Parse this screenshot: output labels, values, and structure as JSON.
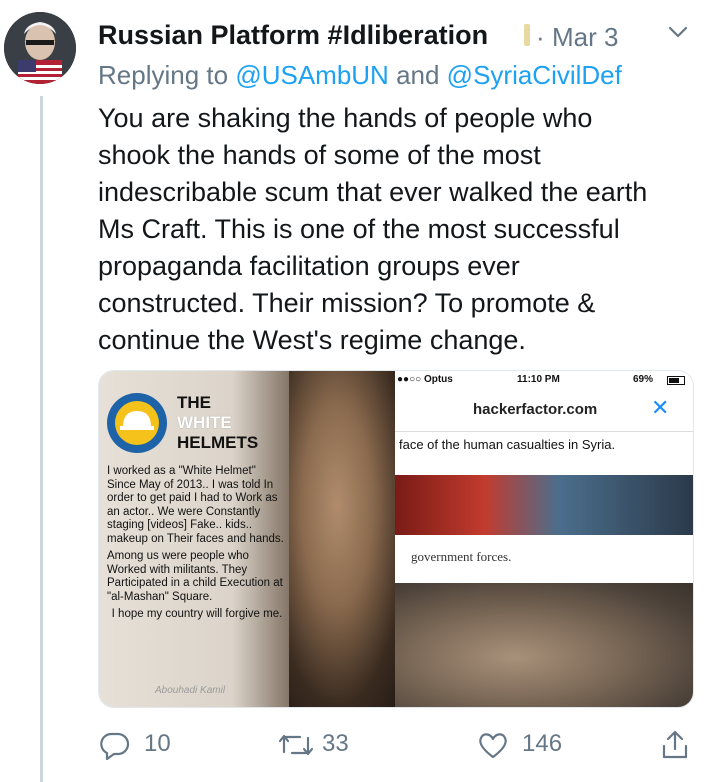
{
  "tweet": {
    "author_name": "Russian Platform #Idliberation",
    "separator": "·",
    "date": "Mar 3",
    "reply_prefix": "Replying to ",
    "reply_mention_1": "@USAmbUN",
    "reply_and": " and ",
    "reply_mention_2": "@SyriaCivilDef",
    "text_lines": [
      "You are shaking the hands of people who",
      "shook the hands of some of the most",
      "indescribable scum that ever walked the earth",
      "Ms Craft. This is one of the most successful",
      "propaganda facilitation groups ever",
      "constructed. Their mission? To promote &",
      "continue the West's regime change."
    ]
  },
  "media": {
    "left_panel": {
      "title_line1": "THE",
      "title_line2": "WHITE",
      "title_line3": "HELMETS",
      "para1": "I worked as a \"White Helmet\" Since May of 2013.. I was told In order to get paid I had to Work as an actor.. We were Constantly staging [videos] Fake.. kids.. makeup on Their faces and hands.",
      "para2": "Among us were people who Worked with militants. They Participated in a child Execution at \"al-Mashan\" Square.",
      "para3": "I hope my country will forgive me.",
      "signature": "Abouhadi Kamil"
    },
    "right_panel": {
      "carrier": "●●○○ Optus",
      "time": "11:10 PM",
      "battery": "69%",
      "url": "hackerfactor.com",
      "close_glyph": "✕",
      "caption1": "face of the human casualties in Syria.",
      "caption2": "government forces."
    }
  },
  "actions": {
    "reply_count": "10",
    "retweet_count": "33",
    "like_count": "146"
  },
  "icons": {
    "reply": "reply-icon",
    "retweet": "retweet-icon",
    "like": "heart-icon",
    "share": "share-icon",
    "menu": "chevron-down-icon"
  },
  "colors": {
    "link": "#1da1f2",
    "muted": "#657786",
    "text": "#14171a",
    "thread_line": "#ccd6dd"
  }
}
